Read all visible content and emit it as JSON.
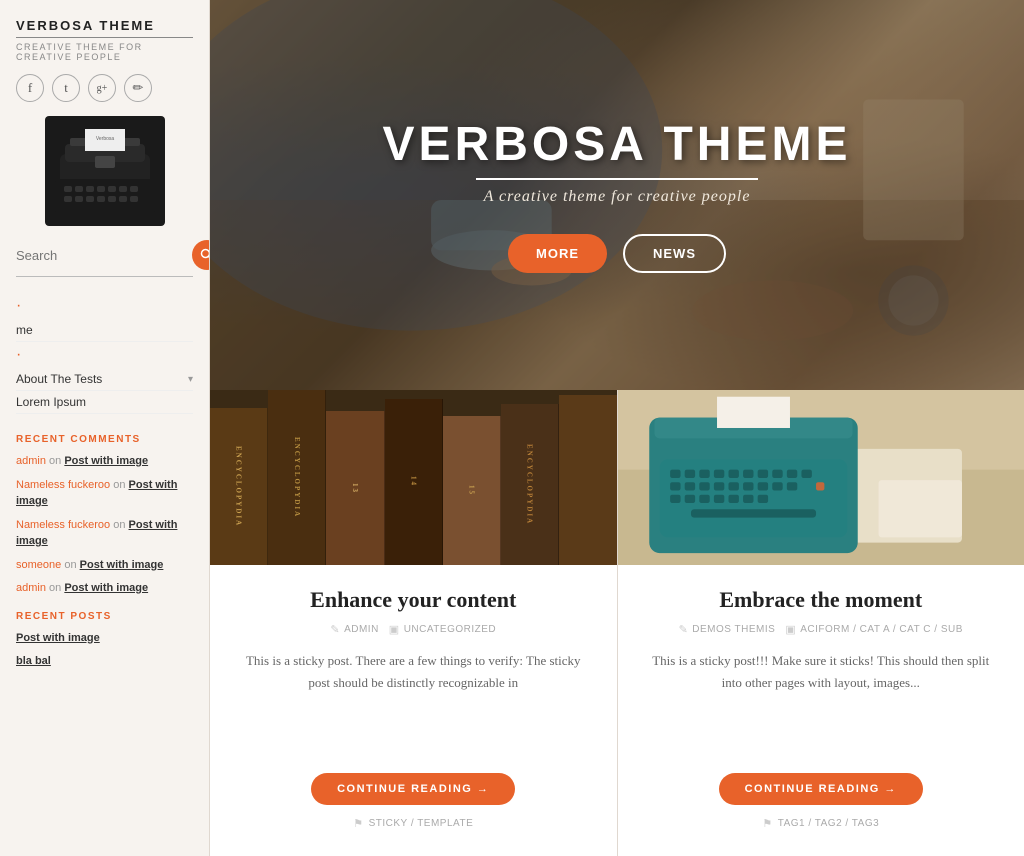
{
  "sidebar": {
    "title": "VERBOSA THEME",
    "subtitle": "CREATIVE THEME FOR CREATIVE PEOPLE",
    "social": [
      {
        "icon": "f",
        "name": "facebook"
      },
      {
        "icon": "t",
        "name": "twitter"
      },
      {
        "icon": "g+",
        "name": "googleplus"
      },
      {
        "icon": "✏",
        "name": "edit"
      }
    ],
    "search": {
      "placeholder": "Search",
      "button_label": "🔍"
    },
    "nav": [
      {
        "label": "·",
        "is_dot": true
      },
      {
        "label": "me"
      },
      {
        "label": "·",
        "is_dot": true
      },
      {
        "label": "About The Tests",
        "has_arrow": true
      },
      {
        "label": "Lorem Ipsum"
      }
    ],
    "recent_comments": {
      "section_title": "RECENT COMMENTS",
      "items": [
        {
          "author": "admin",
          "action": "on",
          "post": "Post with image"
        },
        {
          "author": "Nameless fuckeroo",
          "action": "on",
          "post": "Post with image"
        },
        {
          "author": "Nameless fuckeroo",
          "action": "on",
          "post": "Post with image"
        },
        {
          "author": "someone",
          "action": "on",
          "post": "Post with image"
        },
        {
          "author": "admin",
          "action": "on",
          "post": "Post with image"
        }
      ]
    },
    "recent_posts": {
      "section_title": "RECENT POSTS",
      "items": [
        "Post with image",
        "bla bal"
      ]
    }
  },
  "hero": {
    "title": "VERBOSA THEME",
    "subtitle": "A creative theme for creative people",
    "btn_more": "MORE",
    "btn_news": "NEWS"
  },
  "posts": [
    {
      "title": "Enhance your content",
      "meta_author": "ADMIN",
      "meta_category": "UNCATEGORIZED",
      "excerpt": "This is a sticky post. There are a few things to verify: The sticky post should be distinctly recognizable in",
      "continue_label": "CONTINUE READING →",
      "tags": "STICKY / TEMPLATE",
      "image_type": "books"
    },
    {
      "title": "Embrace the moment",
      "meta_author": "DEMOS THEMIS",
      "meta_category": "ACIFORM / CAT A / CAT C / SUB",
      "excerpt": "This is a sticky post!!! Make sure it sticks! This should then split into other pages with layout, images...",
      "continue_label": "CONTINUE READING →",
      "tags": "TAG1 / TAG2 / TAG3",
      "image_type": "typewriter"
    }
  ],
  "accent_color": "#e8622a"
}
